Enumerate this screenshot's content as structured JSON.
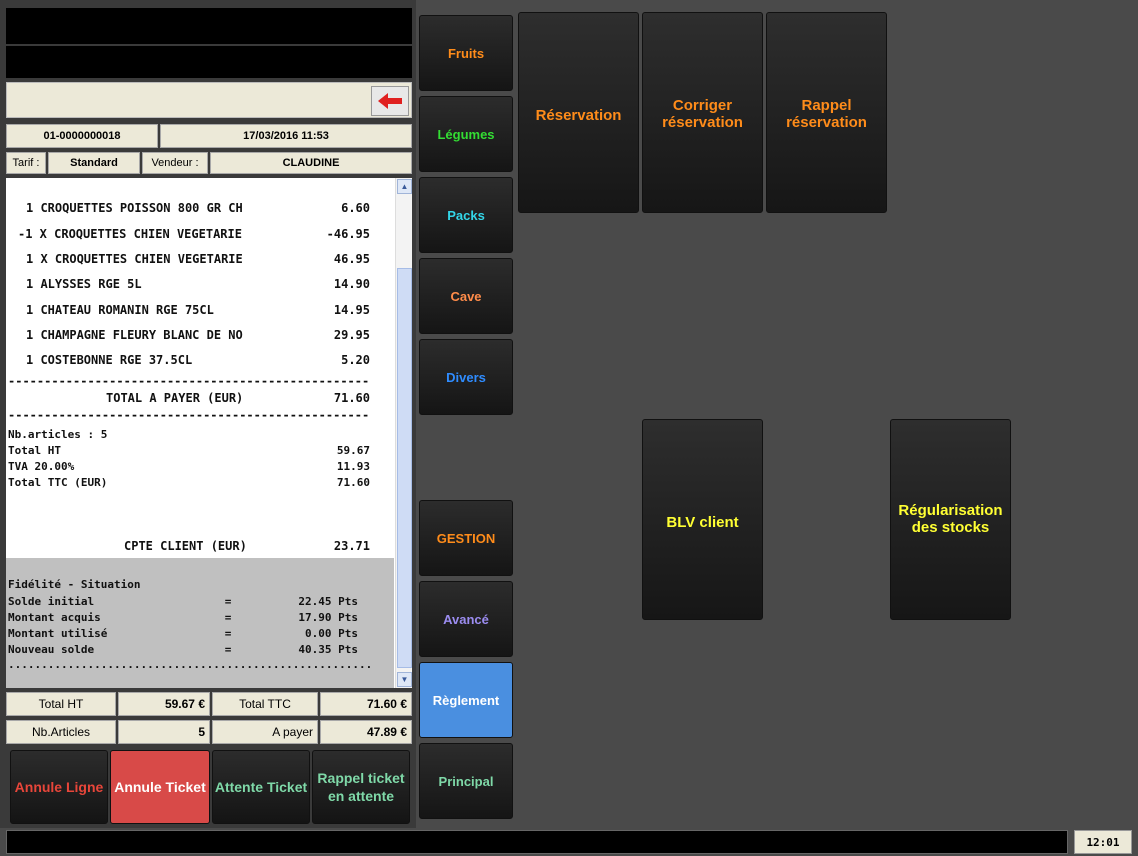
{
  "ticket_header": {
    "ticket_number": "01-0000000018",
    "datetime": "17/03/2016 11:53",
    "tarif_label": "Tarif :",
    "tarif_value": "Standard",
    "vendeur_label": "Vendeur :",
    "vendeur_value": "CLAUDINE"
  },
  "icons": {
    "back": "back-arrow-icon",
    "scroll_up": "scroll-up-icon",
    "scroll_down": "scroll-down-icon"
  },
  "lines": [
    {
      "text": "1 CROQUETTES POISSON 800 GR CH",
      "amount": "6.60"
    },
    {
      "text": "-1 X CROQUETTES CHIEN VEGETARIE",
      "amount": "-46.95"
    },
    {
      "text": "1 X CROQUETTES CHIEN VEGETARIE",
      "amount": "46.95"
    },
    {
      "text": "1 ALYSSES RGE 5L",
      "amount": "14.90"
    },
    {
      "text": "1 CHATEAU ROMANIN RGE 75CL",
      "amount": "14.95"
    },
    {
      "text": "1 CHAMPAGNE FLEURY BLANC DE NO",
      "amount": "29.95"
    },
    {
      "text": "1 COSTEBONNE RGE 37.5CL",
      "amount": "5.20"
    }
  ],
  "separator": "------------------------------------------------------------",
  "dots": ".........................................................",
  "total": {
    "label": "TOTAL A PAYER (EUR)",
    "amount": "71.60"
  },
  "details": [
    {
      "label": "Nb.articles : 5",
      "amount": ""
    },
    {
      "label": "Total HT",
      "amount": "59.67"
    },
    {
      "label": "TVA 20.00%",
      "amount": "11.93"
    },
    {
      "label": "Total TTC (EUR)",
      "amount": "71.60"
    }
  ],
  "cpte_client": {
    "label": "CPTE CLIENT (EUR)",
    "amount": "23.71"
  },
  "fidelite": {
    "title": "Fidélité - Situation",
    "rows": [
      {
        "label": "Solde initial",
        "eq": "=",
        "value": "22.45 Pts"
      },
      {
        "label": "Montant acquis",
        "eq": "=",
        "value": "17.90 Pts"
      },
      {
        "label": "Montant utilisé",
        "eq": "=",
        "value": "0.00 Pts"
      },
      {
        "label": "Nouveau solde",
        "eq": "=",
        "value": "40.35 Pts"
      }
    ]
  },
  "summary": {
    "total_ht_label": "Total HT",
    "total_ht_value": "59.67 €",
    "total_ttc_label": "Total TTC",
    "total_ttc_value": "71.60 €",
    "nb_articles_label": "Nb.Articles",
    "nb_articles_value": "5",
    "a_payer_label": "A payer",
    "a_payer_value": "47.89 €"
  },
  "actions": [
    {
      "label": "Annule Ligne",
      "color": "#e8463a",
      "bg": ""
    },
    {
      "label": "Annule Ticket",
      "color": "#ffffff",
      "bg": "#d84a48"
    },
    {
      "label": "Attente Ticket",
      "color": "#7fd9a8",
      "bg": ""
    },
    {
      "label": "Rappel ticket en attente",
      "color": "#7fd9a8",
      "bg": ""
    }
  ],
  "categories": [
    {
      "label": "Fruits",
      "color": "#ff8c1a"
    },
    {
      "label": "Légumes",
      "color": "#33dd33"
    },
    {
      "label": "Packs",
      "color": "#33d6e8"
    },
    {
      "label": "Cave",
      "color": "#ff8c4a"
    },
    {
      "label": "Divers",
      "color": "#2f8cff"
    },
    {
      "label": "GESTION",
      "color": "#ff8c1a"
    },
    {
      "label": "Avancé",
      "color": "#9b8cf0"
    },
    {
      "label": "Règlement",
      "color": "#ffffff"
    },
    {
      "label": "Principal",
      "color": "#7fd9a8"
    }
  ],
  "functions": [
    {
      "label": "Réservation",
      "color": "#ff8c1a"
    },
    {
      "label": "Corriger réservation",
      "color": "#ff8c1a"
    },
    {
      "label": "Rappel réservation",
      "color": "#ff8c1a"
    },
    {
      "label": "BLV client",
      "color": "#ffff33"
    },
    {
      "label": "Régularisation des stocks",
      "color": "#ffff33"
    }
  ],
  "colors": {
    "selected_category_bg": "#4a8fe0"
  },
  "clock": "12:01"
}
